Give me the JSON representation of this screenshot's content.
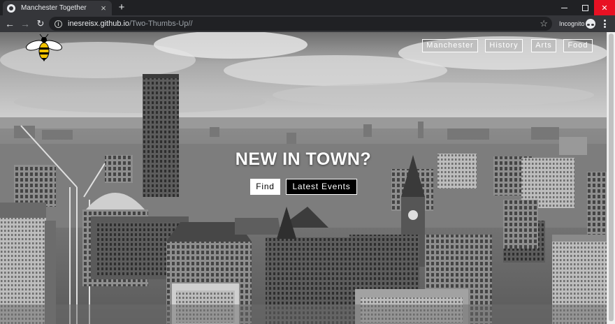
{
  "browser": {
    "tab_title": "Manchester Together",
    "tab_close": "×",
    "new_tab": "+",
    "url_host": "inesreisx.github.io",
    "url_path": "/Two-Thumbs-Up//",
    "incognito_label": "Incognito",
    "back_glyph": "←",
    "forward_glyph": "→",
    "reload_glyph": "↻",
    "star_glyph": "☆",
    "info_glyph": "i",
    "close_glyph": "✕"
  },
  "page": {
    "logo_icon": "worker-bee-icon",
    "nav": [
      "Manchester",
      "History",
      "Arts",
      "Food"
    ],
    "headline": "NEW IN TOWN?",
    "cta_find": "Find",
    "cta_events": "Latest Events",
    "hero_image": "grayscale Manchester city skyline photo",
    "colors": {
      "accent_white": "#ffffff",
      "cta_dark": "#000000",
      "bee_yellow": "#f2c200"
    }
  }
}
